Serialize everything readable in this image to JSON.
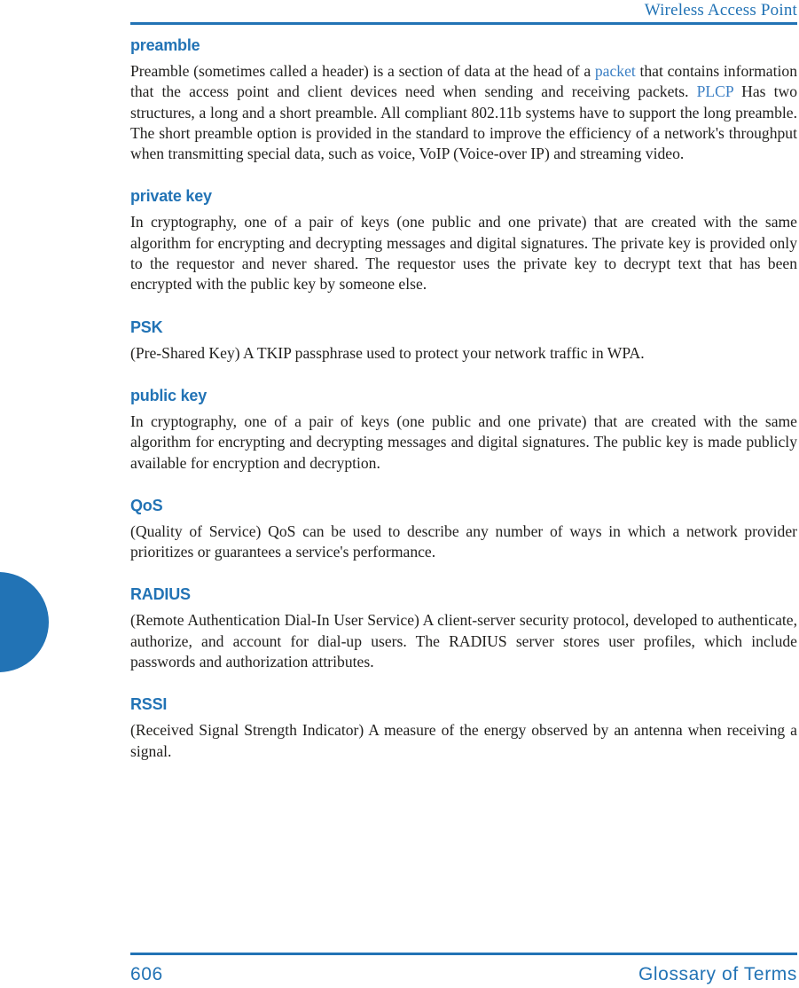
{
  "header": {
    "running_head": "Wireless Access Point"
  },
  "colors": {
    "accent_blue": "#2273b5",
    "link_blue": "#3b7fc4",
    "body_text": "#201f1d"
  },
  "glossary": {
    "entries": [
      {
        "term": "preamble",
        "definition_parts": [
          {
            "type": "text",
            "text": "Preamble (sometimes called a header) is a section of data at the head of a "
          },
          {
            "type": "xref",
            "text": "packet"
          },
          {
            "type": "text",
            "text": " that contains information that the access point and client devices need when sending and receiving packets. "
          },
          {
            "type": "xref",
            "text": "PLCP"
          },
          {
            "type": "text",
            "text": " Has two structures, a long and a short preamble. All compliant 802.11b systems have to support the long preamble. The short preamble option is provided in the standard to improve the efficiency of a network's throughput when transmitting special data, such as voice, VoIP (Voice-over IP) and streaming video."
          }
        ]
      },
      {
        "term": "private key",
        "definition_parts": [
          {
            "type": "text",
            "text": "In cryptography, one of a pair of keys (one public and one private) that are created with the same algorithm for encrypting and decrypting messages and digital signatures. The private key is provided only to the requestor and never shared. The requestor uses the private key to decrypt text that has been encrypted with the public key by someone else."
          }
        ]
      },
      {
        "term": "PSK",
        "single_line": true,
        "definition_parts": [
          {
            "type": "text",
            "text": "(Pre-Shared Key) A TKIP passphrase used to protect your network traffic in WPA."
          }
        ]
      },
      {
        "term": "public key",
        "definition_parts": [
          {
            "type": "text",
            "text": "In cryptography, one of a pair of keys (one public and one private) that are created with the same algorithm for encrypting and decrypting messages and digital signatures. The public key is made publicly available for encryption and decryption."
          }
        ]
      },
      {
        "term": "QoS",
        "definition_parts": [
          {
            "type": "text",
            "text": "(Quality of Service) QoS can be used to describe any number of ways in which a network provider prioritizes or guarantees a service's performance."
          }
        ]
      },
      {
        "term": "RADIUS",
        "definition_parts": [
          {
            "type": "text",
            "text": "(Remote Authentication Dial-In User Service) A client-server security protocol, developed to authenticate, authorize, and account for dial-up users. The RADIUS server stores user profiles, which include passwords and authorization attributes."
          }
        ]
      },
      {
        "term": "RSSI",
        "definition_parts": [
          {
            "type": "text",
            "text": "(Received Signal Strength Indicator) A measure of the energy observed by an antenna when receiving a signal."
          }
        ]
      }
    ]
  },
  "footer": {
    "page_number": "606",
    "section_title": "Glossary of Terms"
  }
}
